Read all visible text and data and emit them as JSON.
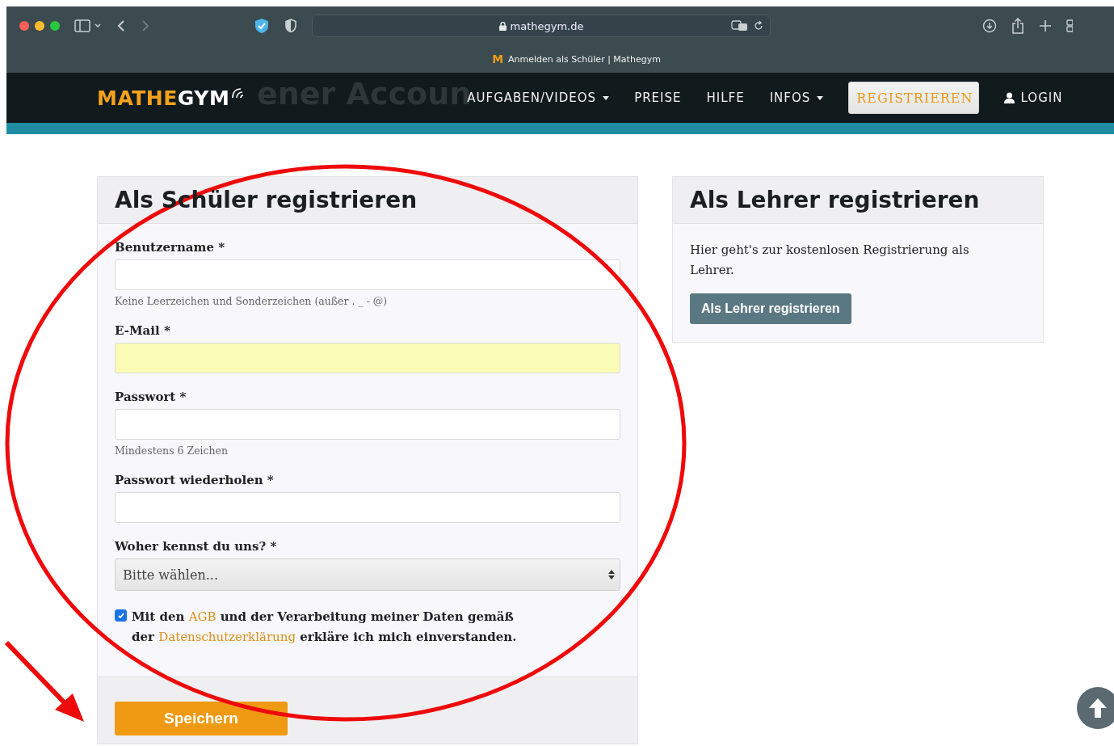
{
  "browser": {
    "address": "mathegym.de",
    "tab_title": "Anmelden als Schüler | Mathegym",
    "tab_favicon": "M"
  },
  "site_nav": {
    "logo_left": "MATHE",
    "logo_right": "GYM",
    "banner_text": "ener Accoun",
    "items": [
      {
        "label": "AUFGABEN/VIDEOS",
        "dropdown": true,
        "selected": false,
        "icon": false
      },
      {
        "label": "PREISE",
        "dropdown": false,
        "selected": false,
        "icon": false
      },
      {
        "label": "HILFE",
        "dropdown": false,
        "selected": false,
        "icon": false
      },
      {
        "label": "INFOS",
        "dropdown": true,
        "selected": false,
        "icon": false
      },
      {
        "label": "REGISTRIEREN",
        "dropdown": false,
        "selected": true,
        "icon": false
      },
      {
        "label": "LOGIN",
        "dropdown": false,
        "selected": false,
        "icon": true
      }
    ]
  },
  "student_card": {
    "title": "Als Schüler registrieren",
    "fields": [
      {
        "kind": "text",
        "label": "Benutzername *",
        "hint": "Keine Leerzeichen und Sonderzeichen (außer . _ - @)",
        "autofilled": false
      },
      {
        "kind": "text",
        "label": "E-Mail *",
        "autofilled": true
      },
      {
        "kind": "text",
        "label": "Passwort *",
        "hint": "Mindestens 6 Zeichen",
        "autofilled": false
      },
      {
        "kind": "text",
        "label": "Passwort wiederholen *",
        "autofilled": false
      },
      {
        "kind": "select",
        "label": "Woher kennst du uns? *",
        "value": "Bitte wählen..."
      }
    ],
    "consent": {
      "checked": true,
      "parts": [
        "Mit den ",
        "AGB",
        " und der Verarbeitung meiner Daten gemäß der ",
        "Datenschutzerklärung",
        " erkläre ich mich einverstanden."
      ]
    },
    "submit": "Speichern"
  },
  "teacher_card": {
    "title": "Als Lehrer registrieren",
    "text": "Hier geht's zur kostenlosen Registrierung als Lehrer.",
    "button": "Als Lehrer registrieren"
  }
}
